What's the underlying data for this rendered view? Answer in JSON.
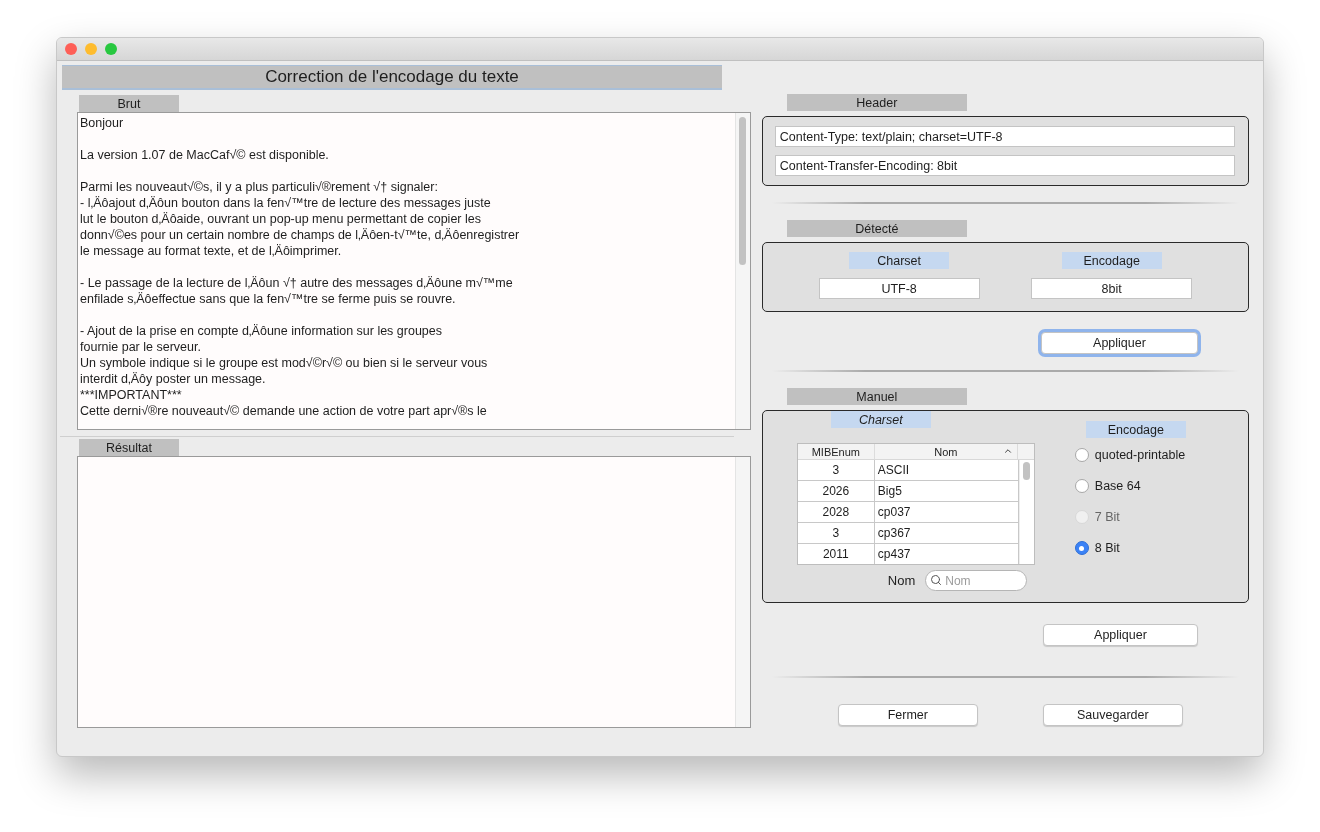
{
  "window": {
    "title": "Correction de l'encodage du texte"
  },
  "brut": {
    "label": "Brut",
    "paragraphs": [
      {
        "lines": [
          "Bonjour"
        ]
      },
      {
        "lines": [
          "La version 1.07 de MacCaf√© est disponible."
        ]
      },
      {
        "lines": [
          "Parmi les nouveaut√©s, il y a plus particuli√®rement √† signaler:",
          "- l‚Äôajout d‚Äôun bouton dans la fen√™tre de lecture des messages juste",
          "lut le bouton d‚Äôaide, ouvrant un pop-up menu permettant de copier les",
          "donn√©es pour un certain nombre de champs de l‚Äôen-t√™te, d‚Äôenregistrer",
          "le message au format texte, et de l‚Äôimprimer."
        ]
      },
      {
        "lines": [
          "- Le passage de la lecture de l‚Äôun √† autre des messages d‚Äôune m√™me",
          "enfilade s‚Äôeffectue sans que la fen√™tre se ferme puis se rouvre."
        ]
      },
      {
        "lines": [
          "- Ajout de la prise en compte d‚Äôune information sur les groupes",
          "fournie par le serveur.",
          "Un symbole indique si le groupe est mod√©r√© ou bien si le serveur vous",
          "interdit d‚Äôy poster un message.",
          "***IMPORTANT***",
          "Cette derni√®re nouveaut√© demande une action de votre part apr√®s le"
        ]
      }
    ]
  },
  "resultat": {
    "label": "Résultat"
  },
  "header": {
    "label": "Header",
    "fields": [
      "Content-Type: text/plain; charset=UTF-8",
      "Content-Transfer-Encoding: 8bit"
    ]
  },
  "detecte": {
    "label": "Détecté",
    "charset_label": "Charset",
    "charset": "UTF-8",
    "encodage_label": "Encodage",
    "encodage": "8bit",
    "apply": "Appliquer"
  },
  "manuel": {
    "label": "Manuel",
    "charset_label": "Charset",
    "columns": [
      "MIBEnum",
      "Nom"
    ],
    "rows": [
      {
        "mibenum": "3",
        "nom": "ASCII"
      },
      {
        "mibenum": "2026",
        "nom": "Big5"
      },
      {
        "mibenum": "2028",
        "nom": "cp037"
      },
      {
        "mibenum": "3",
        "nom": "cp367"
      },
      {
        "mibenum": "2011",
        "nom": "cp437"
      }
    ],
    "search_label": "Nom",
    "search": {
      "placeholder": "Nom"
    },
    "encodage_label": "Encodage",
    "options": [
      {
        "label": "quoted-printable",
        "selected": false,
        "disabled": false
      },
      {
        "label": "Base 64",
        "selected": false,
        "disabled": false
      },
      {
        "label": "7 Bit",
        "selected": false,
        "disabled": true
      },
      {
        "label": "8 Bit",
        "selected": true,
        "disabled": false
      }
    ],
    "apply": "Appliquer"
  },
  "buttons": [
    "Fermer",
    "Sauvegarder"
  ]
}
